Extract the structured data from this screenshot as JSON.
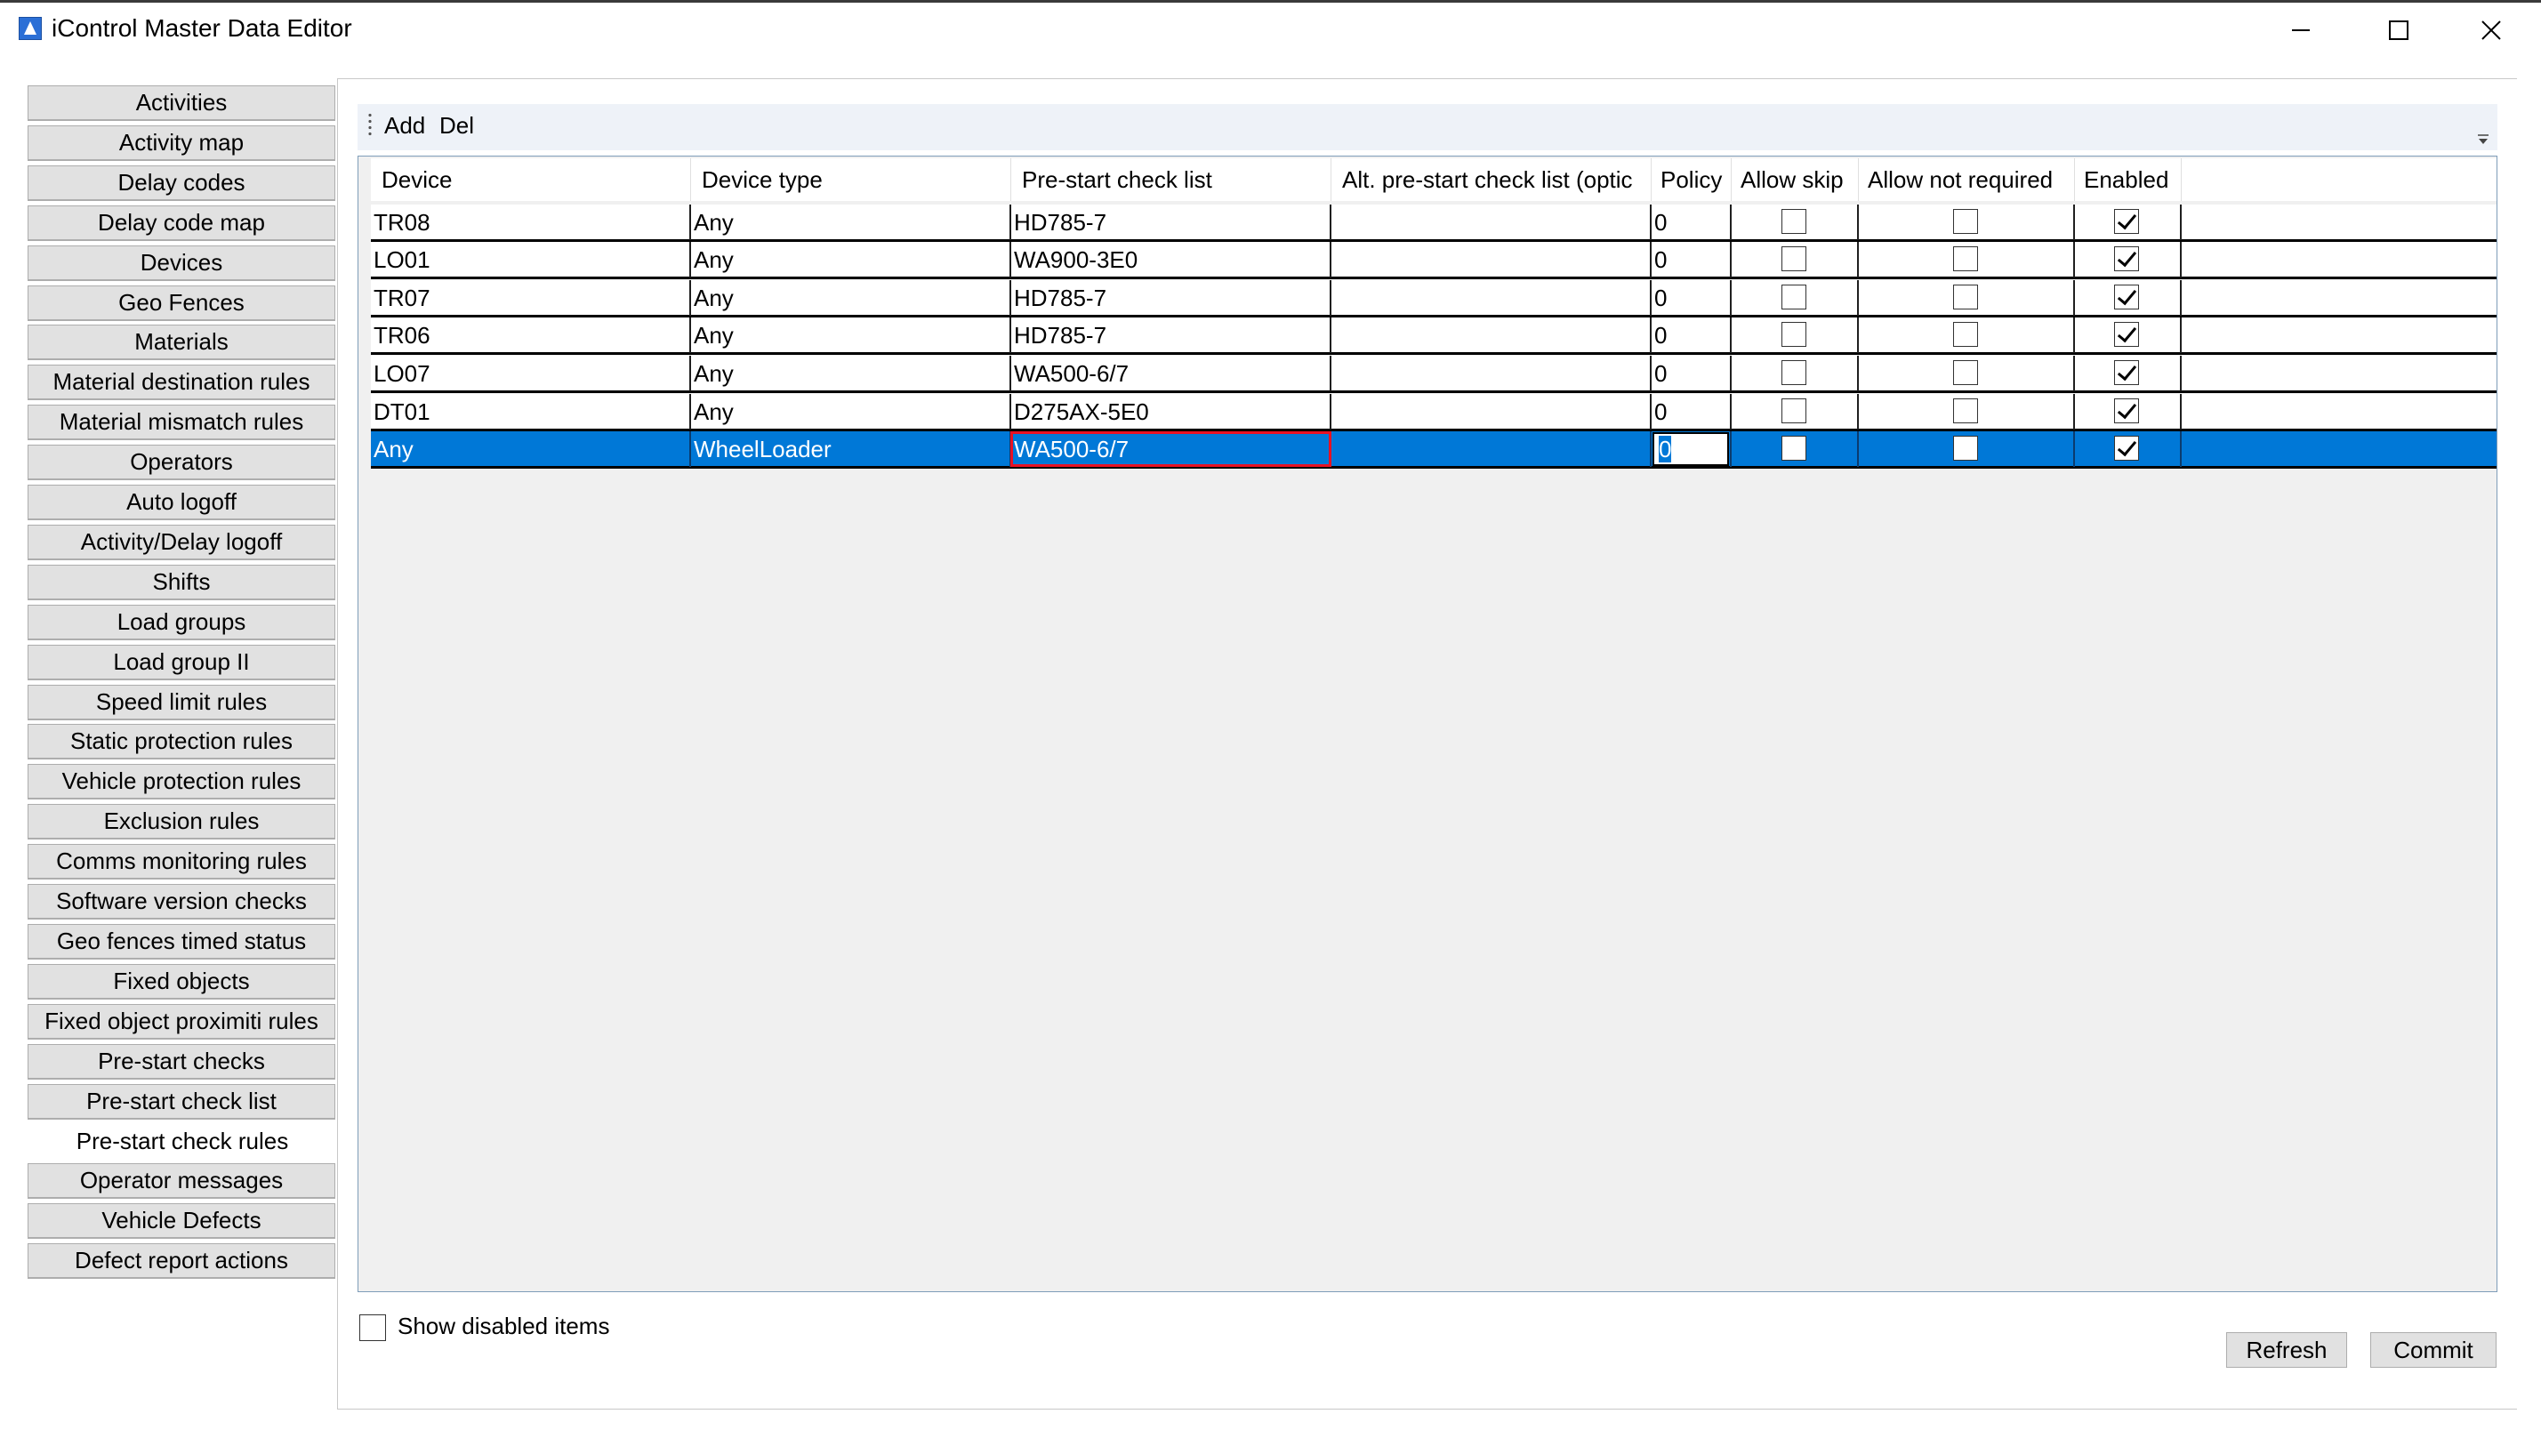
{
  "window": {
    "title": "iControl Master Data Editor",
    "app_icon": "app-logo-icon",
    "controls": [
      "minimize-icon",
      "maximize-icon",
      "close-icon"
    ]
  },
  "sidebar": {
    "items": [
      {
        "label": "Activities"
      },
      {
        "label": "Activity map"
      },
      {
        "label": "Delay codes"
      },
      {
        "label": "Delay code map"
      },
      {
        "label": "Devices"
      },
      {
        "label": "Geo Fences"
      },
      {
        "label": "Materials"
      },
      {
        "label": "Material destination rules"
      },
      {
        "label": "Material mismatch rules"
      },
      {
        "label": "Operators"
      },
      {
        "label": "Auto logoff"
      },
      {
        "label": "Activity/Delay logoff"
      },
      {
        "label": "Shifts"
      },
      {
        "label": "Load groups"
      },
      {
        "label": "Load group II"
      },
      {
        "label": "Speed limit rules"
      },
      {
        "label": "Static protection rules"
      },
      {
        "label": "Vehicle protection rules"
      },
      {
        "label": "Exclusion rules"
      },
      {
        "label": "Comms monitoring rules"
      },
      {
        "label": "Software version checks"
      },
      {
        "label": "Geo fences timed status"
      },
      {
        "label": "Fixed objects"
      },
      {
        "label": "Fixed object proximiti rules"
      },
      {
        "label": "Pre-start checks"
      },
      {
        "label": "Pre-start check list"
      },
      {
        "label": "Pre-start check rules",
        "active": true
      },
      {
        "label": "Operator messages"
      },
      {
        "label": "Vehicle Defects"
      },
      {
        "label": "Defect report actions"
      }
    ]
  },
  "toolbar": {
    "add_label": "Add",
    "del_label": "Del"
  },
  "grid": {
    "columns": [
      "Device",
      "Device type",
      "Pre-start check list",
      "Alt. pre-start check list (optic",
      "Policy",
      "Allow skip",
      "Allow not required",
      "Enabled"
    ],
    "rows": [
      {
        "device": "TR08",
        "device_type": "Any",
        "checklist": "HD785-7",
        "alt_checklist": "",
        "policy": "0",
        "allow_skip": false,
        "allow_not_required": false,
        "enabled": true
      },
      {
        "device": "LO01",
        "device_type": "Any",
        "checklist": "WA900-3E0",
        "alt_checklist": "",
        "policy": "0",
        "allow_skip": false,
        "allow_not_required": false,
        "enabled": true
      },
      {
        "device": "TR07",
        "device_type": "Any",
        "checklist": "HD785-7",
        "alt_checklist": "",
        "policy": "0",
        "allow_skip": false,
        "allow_not_required": false,
        "enabled": true
      },
      {
        "device": "TR06",
        "device_type": "Any",
        "checklist": "HD785-7",
        "alt_checklist": "",
        "policy": "0",
        "allow_skip": false,
        "allow_not_required": false,
        "enabled": true
      },
      {
        "device": "LO07",
        "device_type": "Any",
        "checklist": "WA500-6/7",
        "alt_checklist": "",
        "policy": "0",
        "allow_skip": false,
        "allow_not_required": false,
        "enabled": true
      },
      {
        "device": "DT01",
        "device_type": "Any",
        "checklist": "D275AX-5E0",
        "alt_checklist": "",
        "policy": "0",
        "allow_skip": false,
        "allow_not_required": false,
        "enabled": true
      },
      {
        "device": "Any",
        "device_type": "WheelLoader",
        "checklist": "WA500-6/7",
        "alt_checklist": "",
        "policy": "0",
        "allow_skip": false,
        "allow_not_required": false,
        "enabled": true,
        "selected": true
      }
    ]
  },
  "footer": {
    "show_disabled_label": "Show disabled items",
    "show_disabled_checked": false,
    "refresh_label": "Refresh",
    "commit_label": "Commit"
  },
  "colors": {
    "selection": "#0078d7",
    "toolbar_bg": "#eef2f8",
    "grid_bg": "#f0f0f0",
    "button_bg": "#e1e1e1",
    "focus_border": "#e81123"
  }
}
